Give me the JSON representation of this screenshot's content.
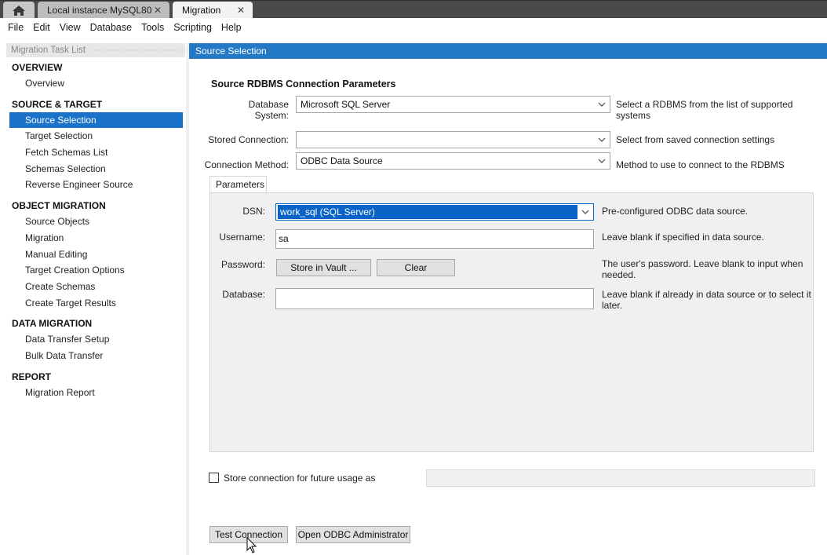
{
  "tabs": {
    "local_label": "Local instance MySQL80",
    "migration_label": "Migration",
    "close_glyph": "✕"
  },
  "menu": [
    "File",
    "Edit",
    "View",
    "Database",
    "Tools",
    "Scripting",
    "Help"
  ],
  "sidebar": {
    "header": "Migration Task List",
    "sections": [
      {
        "title": "OVERVIEW",
        "items": [
          "Overview"
        ]
      },
      {
        "title": "SOURCE & TARGET",
        "items": [
          "Source Selection",
          "Target Selection",
          "Fetch Schemas List",
          "Schemas Selection",
          "Reverse Engineer Source"
        ]
      },
      {
        "title": "OBJECT MIGRATION",
        "items": [
          "Source Objects",
          "Migration",
          "Manual Editing",
          "Target Creation Options",
          "Create Schemas",
          "Create Target Results"
        ]
      },
      {
        "title": "DATA MIGRATION",
        "items": [
          "Data Transfer Setup",
          "Bulk Data Transfer"
        ]
      },
      {
        "title": "REPORT",
        "items": [
          "Migration Report"
        ]
      }
    ]
  },
  "main": {
    "header": "Source Selection",
    "section_title": "Source RDBMS Connection Parameters",
    "database_system": {
      "label": "Database System:",
      "value": "Microsoft SQL Server",
      "hint": "Select a RDBMS from the list of supported systems"
    },
    "stored_connection": {
      "label": "Stored Connection:",
      "value": "",
      "hint": "Select from saved connection settings"
    },
    "connection_method": {
      "label": "Connection Method:",
      "value": "ODBC Data Source",
      "hint": "Method to use to connect to the RDBMS"
    },
    "params_tab": "Parameters",
    "dsn": {
      "label": "DSN:",
      "value": "work_sql (SQL Server)",
      "hint": "Pre-configured ODBC data source."
    },
    "username": {
      "label": "Username:",
      "value": "sa",
      "hint": "Leave blank if specified in data source."
    },
    "password": {
      "label": "Password:",
      "store_button": "Store in Vault ...",
      "clear_button": "Clear",
      "hint_line1": "The user's password. Leave blank to input when",
      "hint_line2": "needed."
    },
    "database": {
      "label": "Database:",
      "value": "",
      "hint_line1": "Leave blank if already in data source or to select it",
      "hint_line2": "later."
    },
    "store_connection_label": "Store connection for future usage as",
    "test_button": "Test Connection",
    "odbc_admin_button": "Open ODBC Administrator"
  },
  "colors": {
    "accent": "#2479c6",
    "selection": "#1a73c8"
  }
}
